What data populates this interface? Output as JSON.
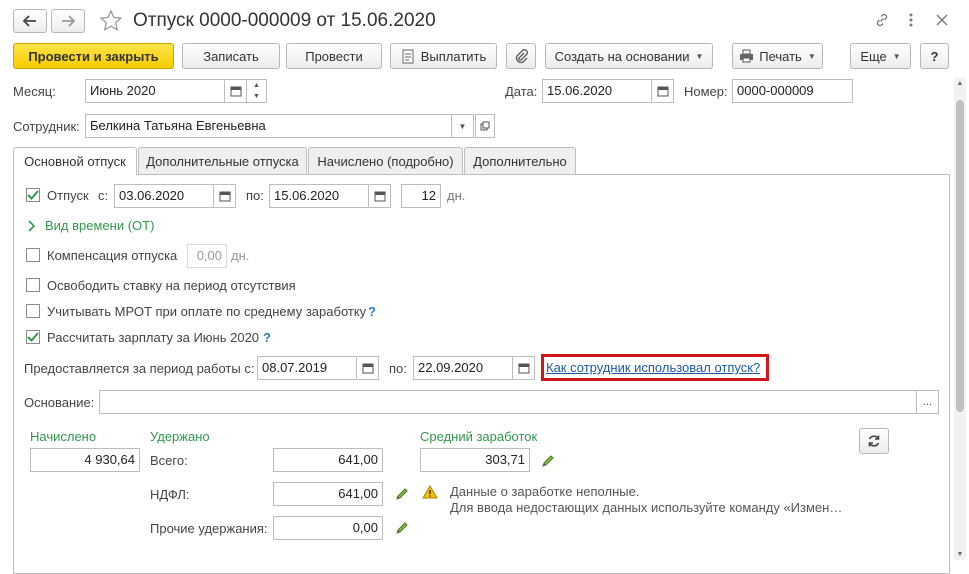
{
  "window": {
    "title": "Отпуск 0000-000009 от 15.06.2020"
  },
  "toolbar": {
    "post_close": "Провести и закрыть",
    "save": "Записать",
    "post": "Провести",
    "pay": "Выплатить",
    "create_based": "Создать на основании",
    "print": "Печать",
    "more": "Еще",
    "help": "?"
  },
  "header": {
    "month_label": "Месяц:",
    "month_value": "Июнь 2020",
    "date_label": "Дата:",
    "date_value": "15.06.2020",
    "number_label": "Номер:",
    "number_value": "0000-000009",
    "employee_label": "Сотрудник:",
    "employee_value": "Белкина Татьяна Евгеньевна"
  },
  "tabs": [
    {
      "label": "Основной отпуск"
    },
    {
      "label": "Дополнительные отпуска"
    },
    {
      "label": "Начислено (подробно)"
    },
    {
      "label": "Дополнительно"
    }
  ],
  "main": {
    "vacation_label": "Отпуск",
    "from_label": "с:",
    "from_value": "03.06.2020",
    "to_label": "по:",
    "to_value": "15.06.2020",
    "days_value": "12",
    "days_unit": "дн.",
    "time_type_link": "Вид времени (ОТ)",
    "compensation_label": "Компенсация отпуска",
    "compensation_value": "0,00",
    "compensation_unit": "дн.",
    "free_rate_label": "Освободить ставку на период отсутствия",
    "mrot_label": "Учитывать МРОТ при оплате по среднему заработку",
    "mrot_help": "?",
    "calc_salary_label": "Рассчитать зарплату за Июнь 2020",
    "calc_salary_help": "?",
    "period_label": "Предоставляется за период работы с:",
    "period_from": "08.07.2019",
    "period_to_label": "по:",
    "period_to": "22.09.2020",
    "usage_link": "Как сотрудник использовал отпуск?",
    "basis_label": "Основание:",
    "basis_value": "",
    "basis_button": "..."
  },
  "summary": {
    "accrued_label": "Начислено",
    "accrued_value": "4 930,64",
    "withheld_label": "Удержано",
    "total_label": "Всего:",
    "total_value": "641,00",
    "ndfl_label": "НДФЛ:",
    "ndfl_value": "641,00",
    "other_label": "Прочие удержания:",
    "other_value": "0,00",
    "avg_label": "Средний заработок",
    "avg_value": "303,71",
    "warning_line1": "Данные о заработке неполные.",
    "warning_line2": "Для ввода недостающих данных используйте команду «Измен…"
  },
  "colors": {
    "primary_button": "#f5cd00",
    "green_label": "#2f9a49",
    "link": "#1a5aa8",
    "highlight_border": "#d2141c"
  }
}
